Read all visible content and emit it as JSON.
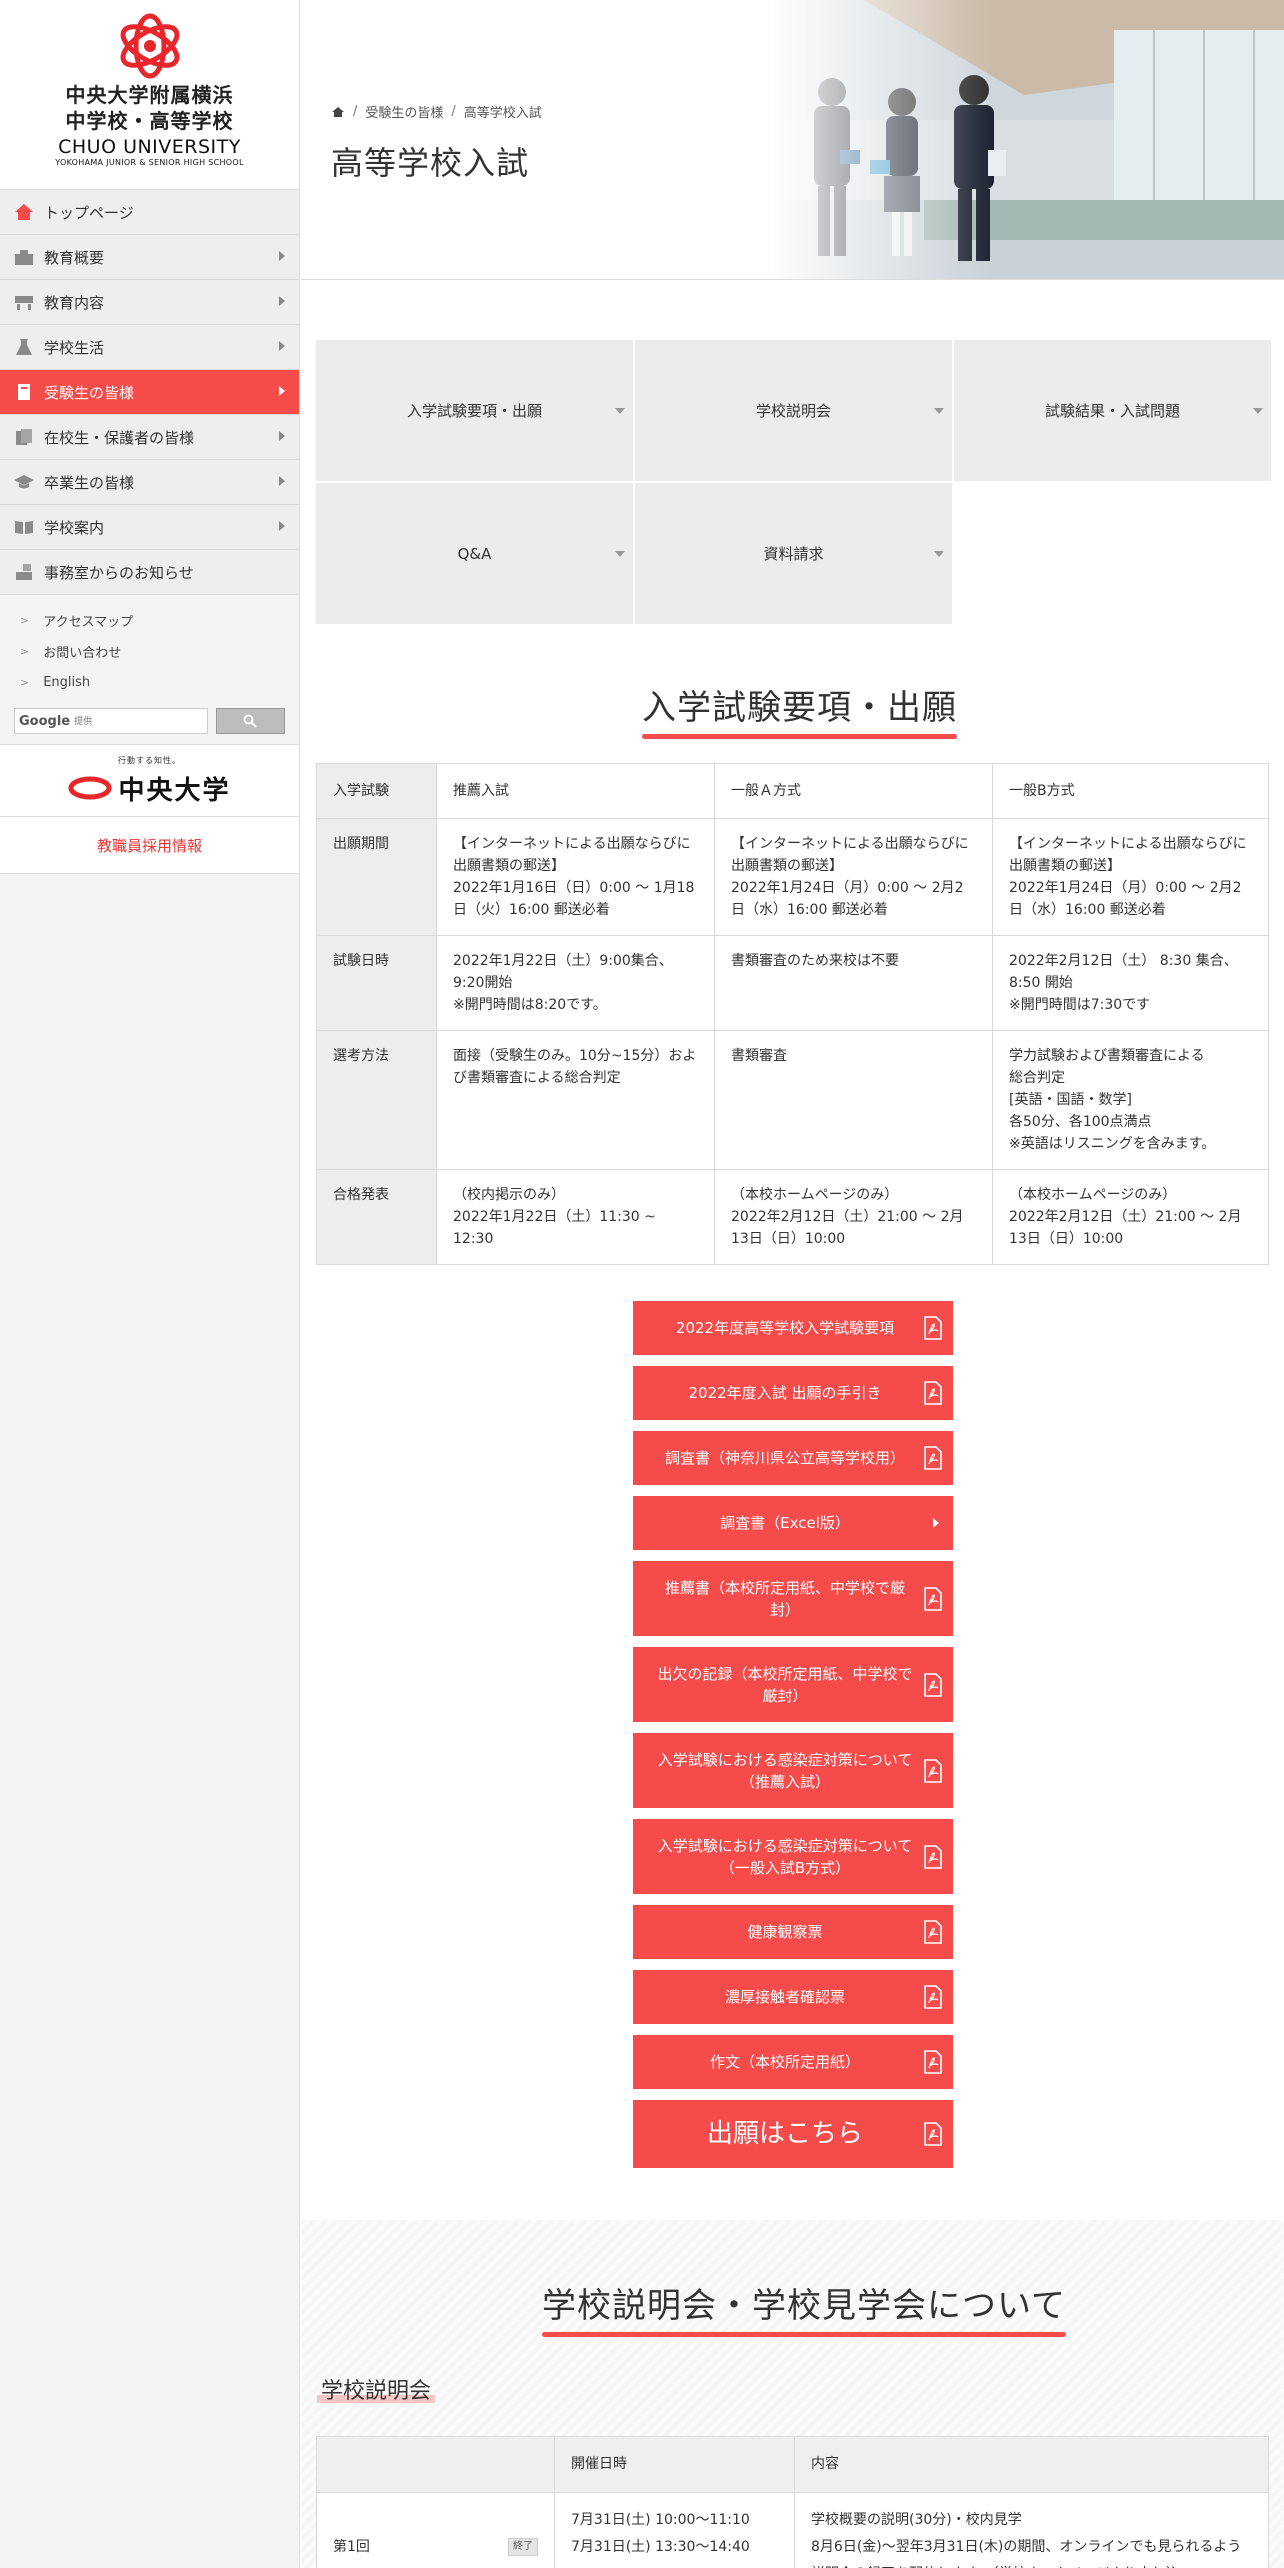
{
  "colors": {
    "accent": "#f54b4b",
    "sidebar_bg": "#f4f4f4",
    "nav_bg": "#eeeeee",
    "cell_head": "#ededed"
  },
  "logo": {
    "line1": "中央大学附属横浜",
    "line2": "中学校・高等学校",
    "en": "CHUO UNIVERSITY",
    "sub": "YOKOHAMA JUNIOR & SENIOR HIGH SCHOOL"
  },
  "nav": [
    {
      "label": "トップページ",
      "icon": "home-icon"
    },
    {
      "label": "教育概要",
      "icon": "building-icon"
    },
    {
      "label": "教育内容",
      "icon": "desk-icon"
    },
    {
      "label": "学校生活",
      "icon": "flask-icon"
    },
    {
      "label": "受験生の皆様",
      "icon": "book-icon"
    },
    {
      "label": "在校生・保護者の皆様",
      "icon": "documents-icon"
    },
    {
      "label": "卒業生の皆様",
      "icon": "graduation-cap-icon"
    },
    {
      "label": "学校案内",
      "icon": "open-book-icon"
    },
    {
      "label": "事務室からのお知らせ",
      "icon": "notice-icon"
    }
  ],
  "subnav": [
    {
      "label": "アクセスマップ"
    },
    {
      "label": "お問い合わせ"
    },
    {
      "label": "English"
    }
  ],
  "search": {
    "brand": "Google",
    "placeholder": "提供"
  },
  "chuo": {
    "tagline": "行動する知性。",
    "name": "中央大学"
  },
  "recruit": {
    "label": "教職員採用情報"
  },
  "breadcrumb": {
    "parent": "受験生の皆様",
    "current": "高等学校入試"
  },
  "page_title": "高等学校入試",
  "tabs": [
    {
      "label": "入学試験要項・出願"
    },
    {
      "label": "学校説明会"
    },
    {
      "label": "試験結果・入試問題"
    },
    {
      "label": "Q&A"
    },
    {
      "label": "資料請求"
    }
  ],
  "exam_section": {
    "title": "入学試験要項・出願",
    "headers": [
      "入学試験",
      "推薦入試",
      "一般Ａ方式",
      "一般B方式"
    ],
    "rows": [
      {
        "label": "出願期間",
        "cells": [
          [
            "【インターネットによる出願ならびに出願書類の郵送】",
            "2022年1月16日（日）0:00 ～ 1月18日（火）16:00 郵送必着"
          ],
          [
            "【インターネットによる出願ならびに出願書類の郵送】",
            "2022年1月24日（月）0:00 ～ 2月2日（水）16:00 郵送必着"
          ],
          [
            "【インターネットによる出願ならびに出願書類の郵送】",
            "2022年1月24日（月）0:00 ～ 2月2日（水）16:00 郵送必着"
          ]
        ]
      },
      {
        "label": "試験日時",
        "cells": [
          [
            "2022年1月22日（土）9:00集合、9:20開始",
            "※開門時間は8:20です。"
          ],
          [
            "書類審査のため来校は不要"
          ],
          [
            "2022年2月12日（土） 8:30 集合、8:50 開始",
            "※開門時間は7:30です"
          ]
        ]
      },
      {
        "label": "選考方法",
        "cells": [
          [
            "面接（受験生のみ。10分~15分）および書類審査による総合判定"
          ],
          [
            "書類審査"
          ],
          [
            "学力試験および書類審査による",
            "総合判定",
            "[英語・国語・数学]",
            "各50分、各100点満点",
            "※英語はリスニングを含みます。"
          ]
        ]
      },
      {
        "label": "合格発表",
        "cells": [
          [
            "（校内掲示のみ）",
            "2022年1月22日（土）11:30 ~ 12:30"
          ],
          [
            "（本校ホームページのみ）",
            "2022年2月12日（土）21:00 ～ 2月13日（日）10:00"
          ],
          [
            "（本校ホームページのみ）",
            "2022年2月12日（土）21:00 ～ 2月13日（日）10:00"
          ]
        ]
      }
    ]
  },
  "buttons": [
    {
      "label": "2022年度高等学校入学試験要項",
      "icon": "pdf-icon"
    },
    {
      "label": "2022年度入試 出願の手引き",
      "icon": "pdf-icon"
    },
    {
      "label": "調査書（神奈川県公立高等学校用）",
      "icon": "pdf-icon"
    },
    {
      "label": "調査書（Excel版）",
      "icon": "arrow-right-icon"
    },
    {
      "label": "推薦書（本校所定用紙、中学校で厳封）",
      "icon": "pdf-icon"
    },
    {
      "label": "出欠の記録（本校所定用紙、中学校で厳封）",
      "icon": "pdf-icon"
    },
    {
      "label": "入学試験における感染症対策について（推薦入試）",
      "icon": "pdf-icon"
    },
    {
      "label": "入学試験における感染症対策について（一般入試B方式）",
      "icon": "pdf-icon"
    },
    {
      "label": "健康観察票",
      "icon": "pdf-icon"
    },
    {
      "label": "濃厚接触者確認票",
      "icon": "pdf-icon"
    },
    {
      "label": "作文（本校所定用紙）",
      "icon": "pdf-icon"
    },
    {
      "label": "出願はこちら",
      "icon": "pdf-icon"
    }
  ],
  "info_section": {
    "title": "学校説明会・学校見学会について",
    "subtitle": "学校説明会",
    "headers": [
      "",
      "開催日時",
      "内容"
    ],
    "rows": [
      {
        "label": "第1回",
        "badge": "終了",
        "dates": [
          "7月31日(土) 10:00～11:10",
          "7月31日(土) 13:30～14:40"
        ],
        "content": [
          "学校概要の説明(30分)・校内見学",
          "8月6日(金)～翌年3月31日(木)の期間、オンラインでも見られるよう説明会の録画を配信します。（学校ホームページより申し込"
        ]
      }
    ]
  }
}
